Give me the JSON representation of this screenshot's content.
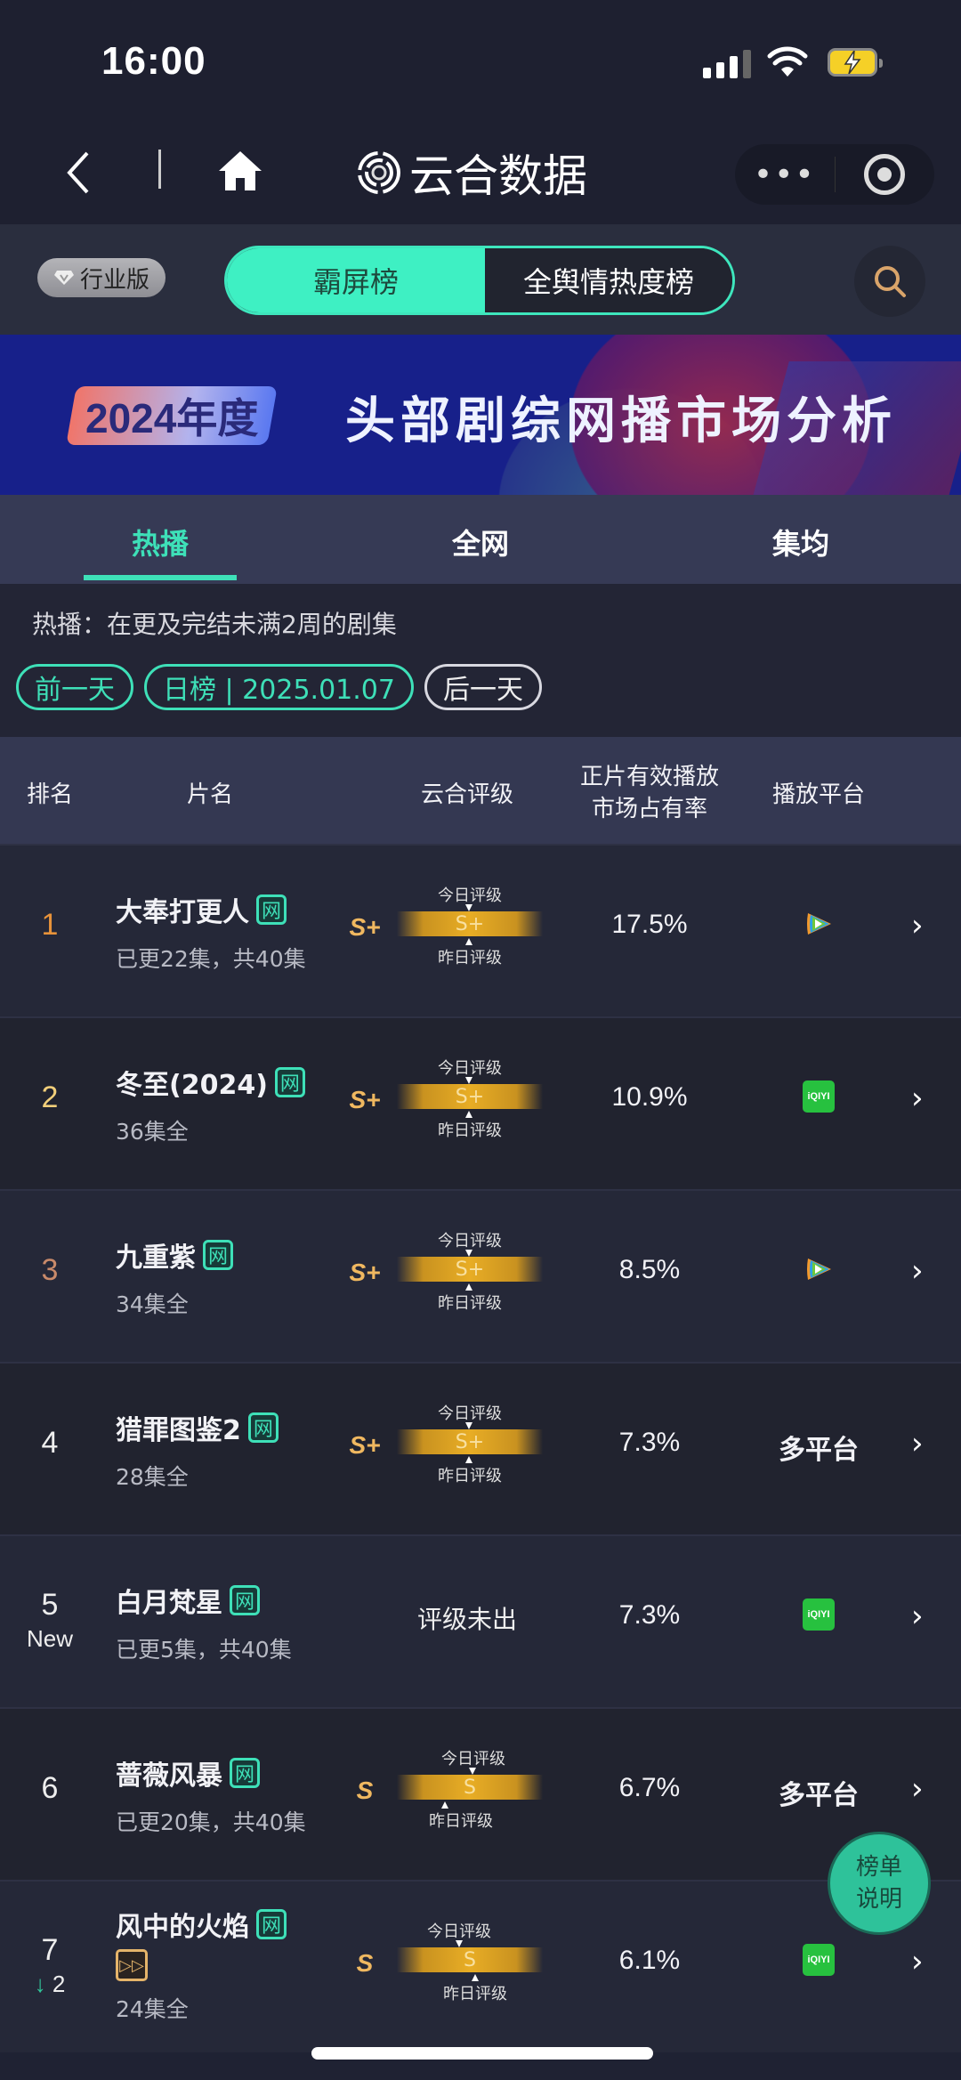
{
  "status_bar": {
    "time": "16:00",
    "icons": [
      "signal-icon",
      "wifi-icon",
      "battery-charging-icon"
    ]
  },
  "nav": {
    "back_icon": "chevron-left-icon",
    "home_icon": "home-icon",
    "app_logo_icon": "yunhe-logo-icon",
    "app_title": "云合数据",
    "more_icon": "more-dots-icon",
    "close_icon": "target-circle-icon",
    "more_label": "•••"
  },
  "toolbar": {
    "edition_badge": "行业版",
    "segments": [
      {
        "label": "霸屏榜",
        "active": true
      },
      {
        "label": "全舆情热度榜",
        "active": false
      }
    ],
    "search_icon": "search-icon"
  },
  "banner": {
    "year_tag": "2024年度",
    "title": "头部剧综网播市场分析"
  },
  "tabs": [
    {
      "label": "热播",
      "active": true
    },
    {
      "label": "全网",
      "active": false
    },
    {
      "label": "集均",
      "active": false
    }
  ],
  "filter": {
    "description": "热播：在更及完结未满2周的剧集",
    "prev_day": "前一天",
    "current": "日榜 | 2025.01.07",
    "next_day": "后一天"
  },
  "table": {
    "headers": {
      "rank": "排名",
      "title": "片名",
      "grade": "云合评级",
      "share_line1": "正片有效播放",
      "share_line2": "市场占有率",
      "platform": "播放平台"
    },
    "grade_today_label": "今日评级",
    "grade_yesterday_label": "昨日评级",
    "badge_label": "网",
    "rows": [
      {
        "rank": "1",
        "rank_change": "",
        "title": "大奉打更人",
        "episodes": "已更22集，共40集",
        "grade": "S+",
        "grade_bar": "S+",
        "share": "17.5%",
        "platform": "腾讯视频",
        "platform_icon": "tencent-video-icon"
      },
      {
        "rank": "2",
        "rank_change": "",
        "title": "冬至(2024)",
        "episodes": "36集全",
        "grade": "S+",
        "grade_bar": "S+",
        "share": "10.9%",
        "platform": "iQIYI",
        "platform_icon": "iqiyi-icon"
      },
      {
        "rank": "3",
        "rank_change": "",
        "title": "九重紫",
        "episodes": "34集全",
        "grade": "S+",
        "grade_bar": "S+",
        "share": "8.5%",
        "platform": "腾讯视频",
        "platform_icon": "tencent-video-icon"
      },
      {
        "rank": "4",
        "rank_change": "",
        "title": "猎罪图鉴2",
        "episodes": "28集全",
        "grade": "S+",
        "grade_bar": "S+",
        "share": "7.3%",
        "platform": "多平台",
        "platform_icon": ""
      },
      {
        "rank": "5",
        "rank_change": "New",
        "title": "白月梵星",
        "episodes": "已更5集，共40集",
        "grade": "评级未出",
        "grade_bar": "",
        "share": "7.3%",
        "platform": "iQIYI",
        "platform_icon": "iqiyi-icon"
      },
      {
        "rank": "6",
        "rank_change": "",
        "title": "蔷薇风暴",
        "episodes": "已更20集，共40集",
        "grade": "S",
        "grade_bar": "S",
        "share": "6.7%",
        "platform": "多平台",
        "platform_icon": ""
      },
      {
        "rank": "7",
        "rank_change": "2",
        "rank_direction": "down",
        "title": "风中的火焰",
        "episodes": "24集全",
        "grade": "S",
        "grade_bar": "S",
        "share": "6.1%",
        "platform": "iQIYI",
        "platform_icon": "iqiyi-icon",
        "extra_badge_icon": "fast-forward-icon"
      }
    ]
  },
  "iqiyi_label": "iQIYI",
  "float_button": {
    "line1": "榜单",
    "line2": "说明"
  },
  "colors": {
    "accent": "#3ee0b8",
    "gold": "#e8ad25",
    "rank1": "#e8933a",
    "rank2": "#f2cf7a",
    "rank3": "#c98a6a",
    "iqiyi": "#27c13f"
  }
}
